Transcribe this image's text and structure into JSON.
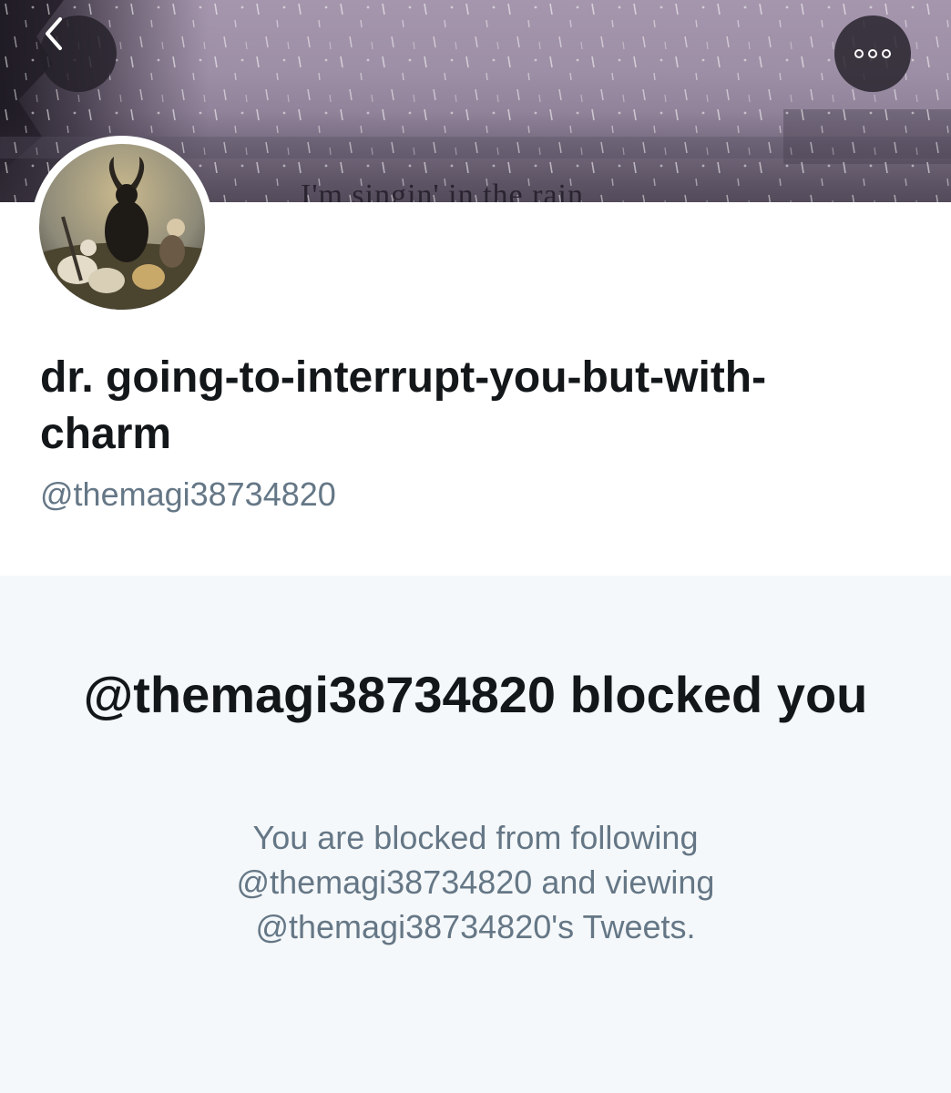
{
  "banner": {
    "caption": "I'm singin' in the rain",
    "back_icon": "chevron-left-icon",
    "more_icon": "more-options-icon"
  },
  "profile": {
    "display_name": "dr. going-to-interrupt-you-but-with-charm",
    "handle": "@themagi38734820"
  },
  "blocked_notice": {
    "title": "@themagi38734820 blocked you",
    "description": "You are blocked from following @themagi38734820 and viewing @themagi38734820's Tweets."
  },
  "colors": {
    "text_primary": "#14171a",
    "text_secondary": "#657786",
    "background": "#f5f8fa",
    "card": "#ffffff"
  }
}
